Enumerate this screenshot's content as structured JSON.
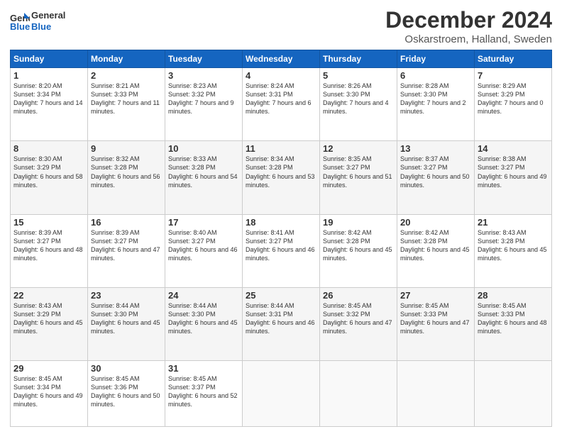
{
  "header": {
    "logo_line1": "General",
    "logo_line2": "Blue",
    "title": "December 2024",
    "subtitle": "Oskarstroem, Halland, Sweden"
  },
  "weekdays": [
    "Sunday",
    "Monday",
    "Tuesday",
    "Wednesday",
    "Thursday",
    "Friday",
    "Saturday"
  ],
  "weeks": [
    [
      {
        "day": "1",
        "sunrise": "Sunrise: 8:20 AM",
        "sunset": "Sunset: 3:34 PM",
        "daylight": "Daylight: 7 hours and 14 minutes."
      },
      {
        "day": "2",
        "sunrise": "Sunrise: 8:21 AM",
        "sunset": "Sunset: 3:33 PM",
        "daylight": "Daylight: 7 hours and 11 minutes."
      },
      {
        "day": "3",
        "sunrise": "Sunrise: 8:23 AM",
        "sunset": "Sunset: 3:32 PM",
        "daylight": "Daylight: 7 hours and 9 minutes."
      },
      {
        "day": "4",
        "sunrise": "Sunrise: 8:24 AM",
        "sunset": "Sunset: 3:31 PM",
        "daylight": "Daylight: 7 hours and 6 minutes."
      },
      {
        "day": "5",
        "sunrise": "Sunrise: 8:26 AM",
        "sunset": "Sunset: 3:30 PM",
        "daylight": "Daylight: 7 hours and 4 minutes."
      },
      {
        "day": "6",
        "sunrise": "Sunrise: 8:28 AM",
        "sunset": "Sunset: 3:30 PM",
        "daylight": "Daylight: 7 hours and 2 minutes."
      },
      {
        "day": "7",
        "sunrise": "Sunrise: 8:29 AM",
        "sunset": "Sunset: 3:29 PM",
        "daylight": "Daylight: 7 hours and 0 minutes."
      }
    ],
    [
      {
        "day": "8",
        "sunrise": "Sunrise: 8:30 AM",
        "sunset": "Sunset: 3:29 PM",
        "daylight": "Daylight: 6 hours and 58 minutes."
      },
      {
        "day": "9",
        "sunrise": "Sunrise: 8:32 AM",
        "sunset": "Sunset: 3:28 PM",
        "daylight": "Daylight: 6 hours and 56 minutes."
      },
      {
        "day": "10",
        "sunrise": "Sunrise: 8:33 AM",
        "sunset": "Sunset: 3:28 PM",
        "daylight": "Daylight: 6 hours and 54 minutes."
      },
      {
        "day": "11",
        "sunrise": "Sunrise: 8:34 AM",
        "sunset": "Sunset: 3:28 PM",
        "daylight": "Daylight: 6 hours and 53 minutes."
      },
      {
        "day": "12",
        "sunrise": "Sunrise: 8:35 AM",
        "sunset": "Sunset: 3:27 PM",
        "daylight": "Daylight: 6 hours and 51 minutes."
      },
      {
        "day": "13",
        "sunrise": "Sunrise: 8:37 AM",
        "sunset": "Sunset: 3:27 PM",
        "daylight": "Daylight: 6 hours and 50 minutes."
      },
      {
        "day": "14",
        "sunrise": "Sunrise: 8:38 AM",
        "sunset": "Sunset: 3:27 PM",
        "daylight": "Daylight: 6 hours and 49 minutes."
      }
    ],
    [
      {
        "day": "15",
        "sunrise": "Sunrise: 8:39 AM",
        "sunset": "Sunset: 3:27 PM",
        "daylight": "Daylight: 6 hours and 48 minutes."
      },
      {
        "day": "16",
        "sunrise": "Sunrise: 8:39 AM",
        "sunset": "Sunset: 3:27 PM",
        "daylight": "Daylight: 6 hours and 47 minutes."
      },
      {
        "day": "17",
        "sunrise": "Sunrise: 8:40 AM",
        "sunset": "Sunset: 3:27 PM",
        "daylight": "Daylight: 6 hours and 46 minutes."
      },
      {
        "day": "18",
        "sunrise": "Sunrise: 8:41 AM",
        "sunset": "Sunset: 3:27 PM",
        "daylight": "Daylight: 6 hours and 46 minutes."
      },
      {
        "day": "19",
        "sunrise": "Sunrise: 8:42 AM",
        "sunset": "Sunset: 3:28 PM",
        "daylight": "Daylight: 6 hours and 45 minutes."
      },
      {
        "day": "20",
        "sunrise": "Sunrise: 8:42 AM",
        "sunset": "Sunset: 3:28 PM",
        "daylight": "Daylight: 6 hours and 45 minutes."
      },
      {
        "day": "21",
        "sunrise": "Sunrise: 8:43 AM",
        "sunset": "Sunset: 3:28 PM",
        "daylight": "Daylight: 6 hours and 45 minutes."
      }
    ],
    [
      {
        "day": "22",
        "sunrise": "Sunrise: 8:43 AM",
        "sunset": "Sunset: 3:29 PM",
        "daylight": "Daylight: 6 hours and 45 minutes."
      },
      {
        "day": "23",
        "sunrise": "Sunrise: 8:44 AM",
        "sunset": "Sunset: 3:30 PM",
        "daylight": "Daylight: 6 hours and 45 minutes."
      },
      {
        "day": "24",
        "sunrise": "Sunrise: 8:44 AM",
        "sunset": "Sunset: 3:30 PM",
        "daylight": "Daylight: 6 hours and 45 minutes."
      },
      {
        "day": "25",
        "sunrise": "Sunrise: 8:44 AM",
        "sunset": "Sunset: 3:31 PM",
        "daylight": "Daylight: 6 hours and 46 minutes."
      },
      {
        "day": "26",
        "sunrise": "Sunrise: 8:45 AM",
        "sunset": "Sunset: 3:32 PM",
        "daylight": "Daylight: 6 hours and 47 minutes."
      },
      {
        "day": "27",
        "sunrise": "Sunrise: 8:45 AM",
        "sunset": "Sunset: 3:33 PM",
        "daylight": "Daylight: 6 hours and 47 minutes."
      },
      {
        "day": "28",
        "sunrise": "Sunrise: 8:45 AM",
        "sunset": "Sunset: 3:33 PM",
        "daylight": "Daylight: 6 hours and 48 minutes."
      }
    ],
    [
      {
        "day": "29",
        "sunrise": "Sunrise: 8:45 AM",
        "sunset": "Sunset: 3:34 PM",
        "daylight": "Daylight: 6 hours and 49 minutes."
      },
      {
        "day": "30",
        "sunrise": "Sunrise: 8:45 AM",
        "sunset": "Sunset: 3:36 PM",
        "daylight": "Daylight: 6 hours and 50 minutes."
      },
      {
        "day": "31",
        "sunrise": "Sunrise: 8:45 AM",
        "sunset": "Sunset: 3:37 PM",
        "daylight": "Daylight: 6 hours and 52 minutes."
      },
      null,
      null,
      null,
      null
    ]
  ]
}
